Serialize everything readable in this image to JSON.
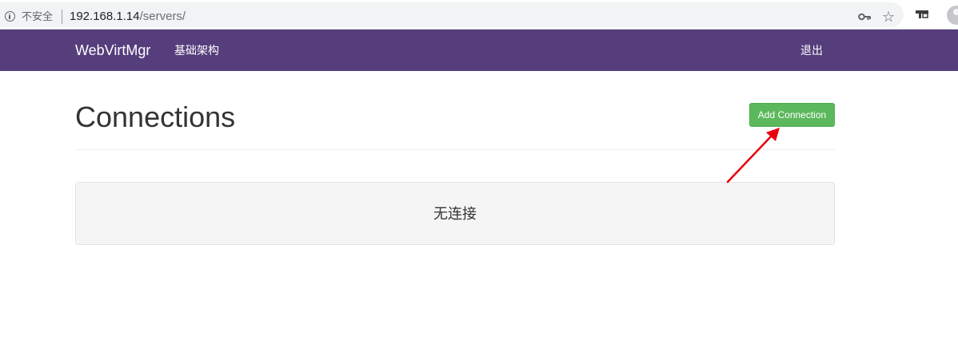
{
  "browser": {
    "security_label": "不安全",
    "url_host": "192.168.1.14",
    "url_path": "/servers/"
  },
  "navbar": {
    "brand": "WebVirtMgr",
    "infrastructure_label": "基础架构",
    "logout_label": "退出"
  },
  "page": {
    "title": "Connections",
    "add_button_label": "Add Connection",
    "empty_message": "无连接"
  },
  "colors": {
    "navbar": "#563d7c",
    "add_button": "#5cb85c",
    "annotation_arrow": "#e8000d"
  },
  "icons": [
    "info-icon",
    "key-icon",
    "star-icon",
    "extension-icon",
    "avatar-icon",
    "annotation-arrow"
  ]
}
